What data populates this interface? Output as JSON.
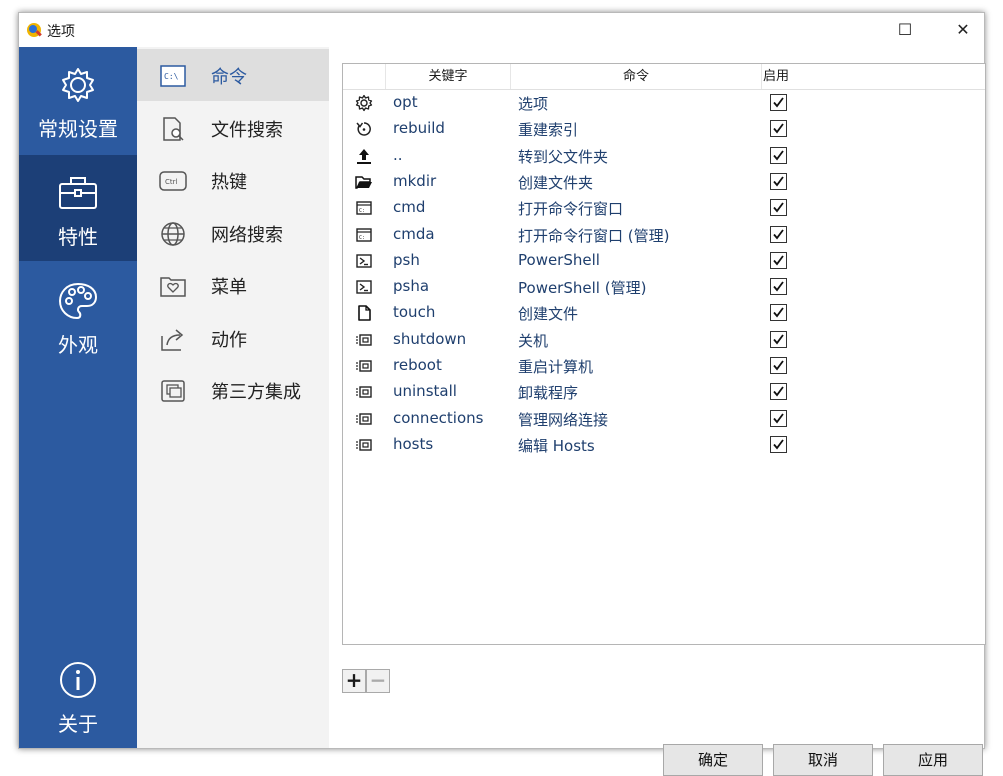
{
  "window": {
    "title": "选项",
    "maximize_glyph": "☐",
    "close_glyph": "✕"
  },
  "sidebar": {
    "items": [
      {
        "label": "常规设置",
        "icon": "gear-icon"
      },
      {
        "label": "特性",
        "icon": "toolbox-icon",
        "active": true
      },
      {
        "label": "外观",
        "icon": "palette-icon"
      },
      {
        "label": "关于",
        "icon": "info-icon"
      }
    ]
  },
  "subnav": {
    "items": [
      {
        "label": "命令",
        "icon": "console-icon",
        "active": true
      },
      {
        "label": "文件搜索",
        "icon": "file-search-icon"
      },
      {
        "label": "热键",
        "icon": "ctrl-key-icon"
      },
      {
        "label": "网络搜索",
        "icon": "globe-icon"
      },
      {
        "label": "菜单",
        "icon": "folder-heart-icon"
      },
      {
        "label": "动作",
        "icon": "share-arrow-icon"
      },
      {
        "label": "第三方集成",
        "icon": "windows-stack-icon"
      }
    ]
  },
  "table": {
    "columns": [
      "关键字",
      "命令",
      "启用"
    ],
    "rows": [
      {
        "icon": "gear-icon",
        "keyword": "opt",
        "command": "选项",
        "enabled": true
      },
      {
        "icon": "refresh-icon",
        "keyword": "rebuild",
        "command": "重建索引",
        "enabled": true
      },
      {
        "icon": "upload-icon",
        "keyword": "..",
        "command": "转到父文件夹",
        "enabled": true
      },
      {
        "icon": "folder-open-icon",
        "keyword": "mkdir",
        "command": "创建文件夹",
        "enabled": true
      },
      {
        "icon": "terminal-icon",
        "keyword": "cmd",
        "command": "打开命令行窗口",
        "enabled": true
      },
      {
        "icon": "terminal-icon",
        "keyword": "cmda",
        "command": "打开命令行窗口 (管理)",
        "enabled": true
      },
      {
        "icon": "powershell-icon",
        "keyword": "psh",
        "command": "PowerShell",
        "enabled": true
      },
      {
        "icon": "powershell-icon",
        "keyword": "psha",
        "command": "PowerShell (管理)",
        "enabled": true
      },
      {
        "icon": "file-icon",
        "keyword": "touch",
        "command": "创建文件",
        "enabled": true
      },
      {
        "icon": "system-icon",
        "keyword": "shutdown",
        "command": "关机",
        "enabled": true
      },
      {
        "icon": "system-icon",
        "keyword": "reboot",
        "command": "重启计算机",
        "enabled": true
      },
      {
        "icon": "system-icon",
        "keyword": "uninstall",
        "command": "卸载程序",
        "enabled": true
      },
      {
        "icon": "system-icon",
        "keyword": "connections",
        "command": "管理网络连接",
        "enabled": true
      },
      {
        "icon": "system-icon",
        "keyword": "hosts",
        "command": "编辑 Hosts",
        "enabled": true
      }
    ]
  },
  "toolbar": {
    "add_glyph": "+",
    "remove_glyph": "−"
  },
  "buttons": {
    "ok": "确定",
    "cancel": "取消",
    "apply": "应用"
  },
  "colors": {
    "sidebar": "#2c5aa0",
    "sidebar_active": "#1c3f77",
    "subnav_bg": "#f3f3f3",
    "subnav_active": "#dedede"
  }
}
